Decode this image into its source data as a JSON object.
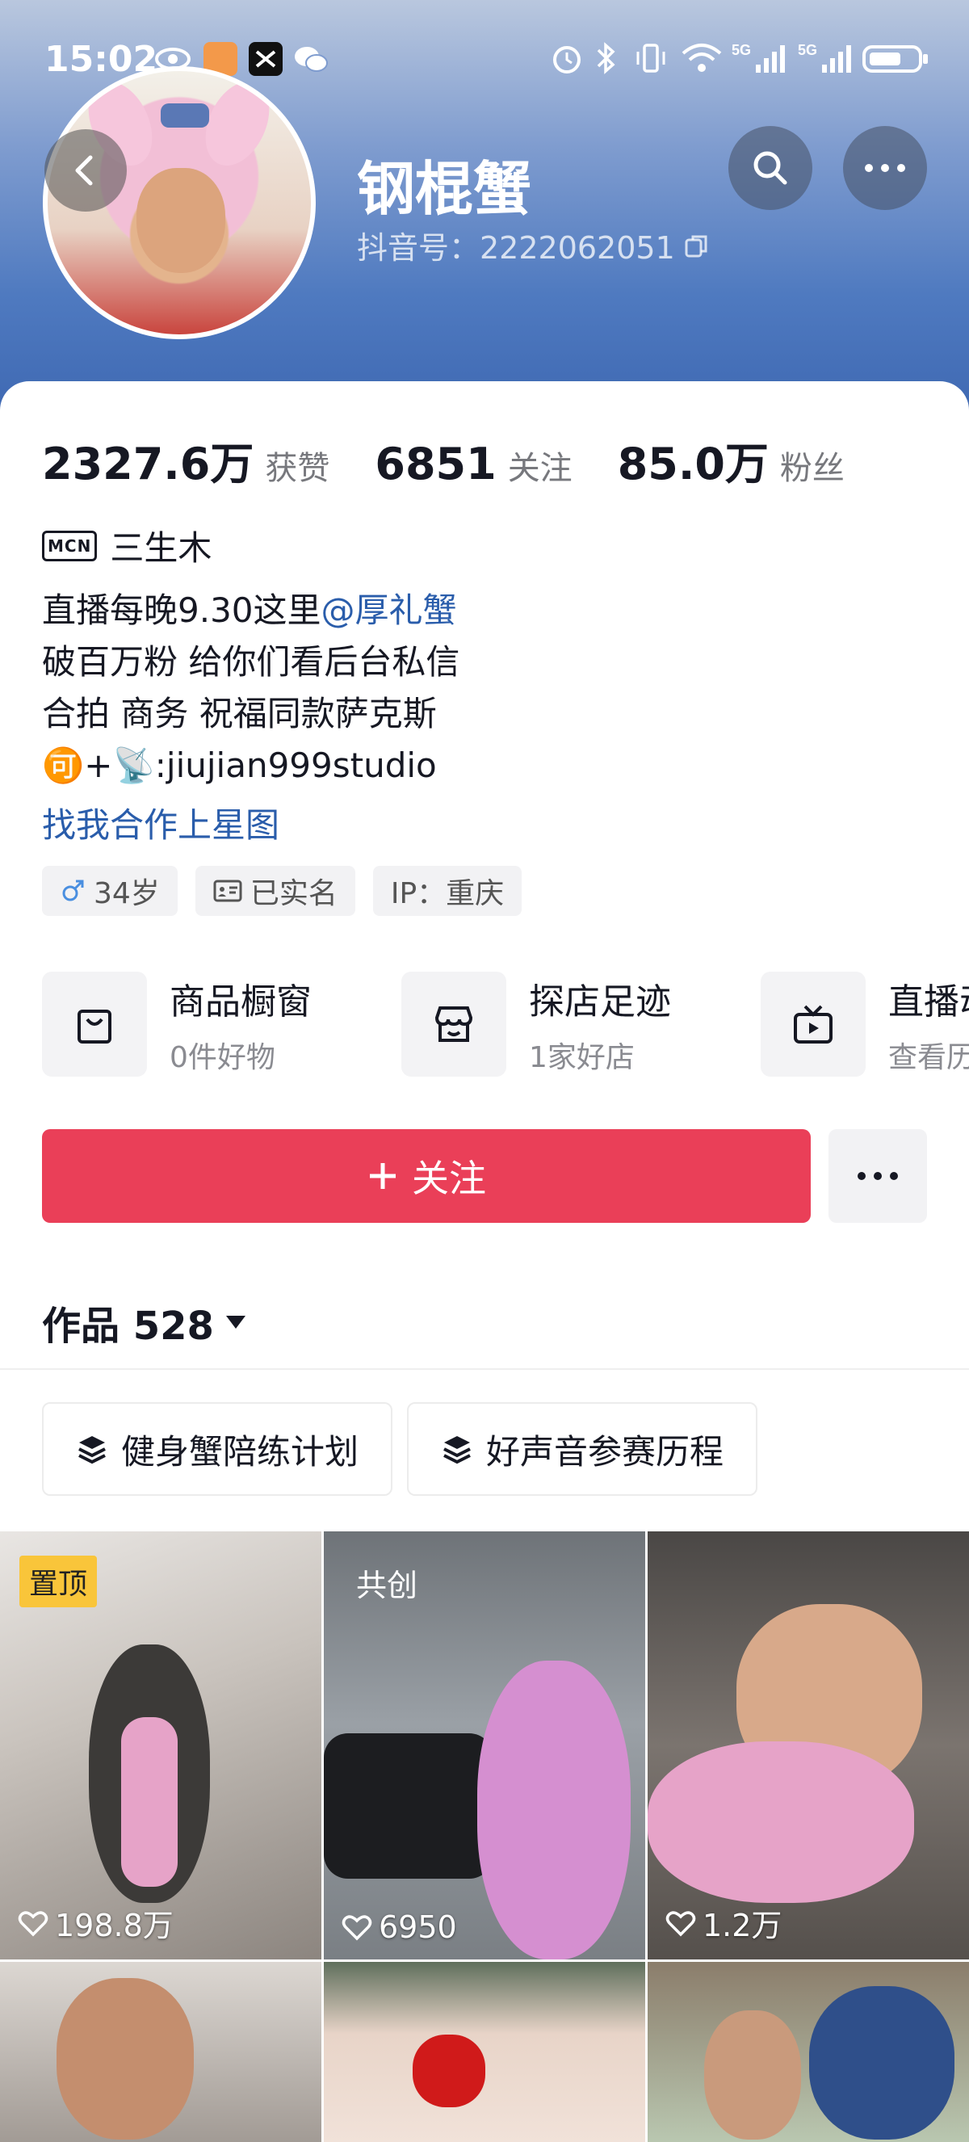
{
  "status_bar": {
    "time": "15:02",
    "icons": [
      "eye-icon",
      "app-badge-icon",
      "capcut-icon",
      "wechat-icon"
    ],
    "right_icons": [
      "alarm-icon",
      "bluetooth-icon",
      "vibrate-icon",
      "wifi-icon",
      "signal-5g-icon",
      "signal-5g-icon",
      "battery-icon"
    ]
  },
  "profile": {
    "nickname": "钢棍蟹",
    "douyin_id": "抖音号：2222062051"
  },
  "stats": [
    {
      "value": "2327.6万",
      "label": "获赞"
    },
    {
      "value": "6851",
      "label": "关注"
    },
    {
      "value": "85.0万",
      "label": "粉丝"
    }
  ],
  "mcn": {
    "badge": "MCN",
    "name": "三生木"
  },
  "bio": {
    "line1_prefix": "直播每晚9.30这里",
    "line1_mention": "@厚礼蟹",
    "line2": "破百万粉 给你们看后台私信",
    "line3": "合拍 商务 祝福同款萨克斯",
    "line4": "🉑+📡:jiujian999studio",
    "link": "找我合作上星图"
  },
  "tags": [
    {
      "icon": "male-icon",
      "text": "34岁"
    },
    {
      "icon": "id-card-icon",
      "text": "已实名"
    },
    {
      "icon": "",
      "text": "IP：重庆"
    }
  ],
  "features": [
    {
      "icon": "shopping-bag-icon",
      "title": "商品橱窗",
      "sub": "0件好物"
    },
    {
      "icon": "store-icon",
      "title": "探店足迹",
      "sub": "1家好店"
    },
    {
      "icon": "tv-icon",
      "title": "直播动态",
      "sub": "查看历史"
    }
  ],
  "actions": {
    "follow_label": "关注"
  },
  "works": {
    "label": "作品 528"
  },
  "collections": [
    {
      "label": "健身蟹陪练计划"
    },
    {
      "label": "好声音参赛历程"
    }
  ],
  "videos": [
    {
      "badge": "置顶",
      "likes": "198.8万"
    },
    {
      "badge": "共创",
      "likes": "6950"
    },
    {
      "badge": "",
      "likes": "1.2万"
    },
    {
      "badge": "",
      "likes": ""
    },
    {
      "badge": "",
      "likes": ""
    },
    {
      "badge": "",
      "likes": ""
    }
  ],
  "colors": {
    "follow": "#ea3f58",
    "link": "#2a5dab",
    "pin_badge": "#f9c53a"
  }
}
